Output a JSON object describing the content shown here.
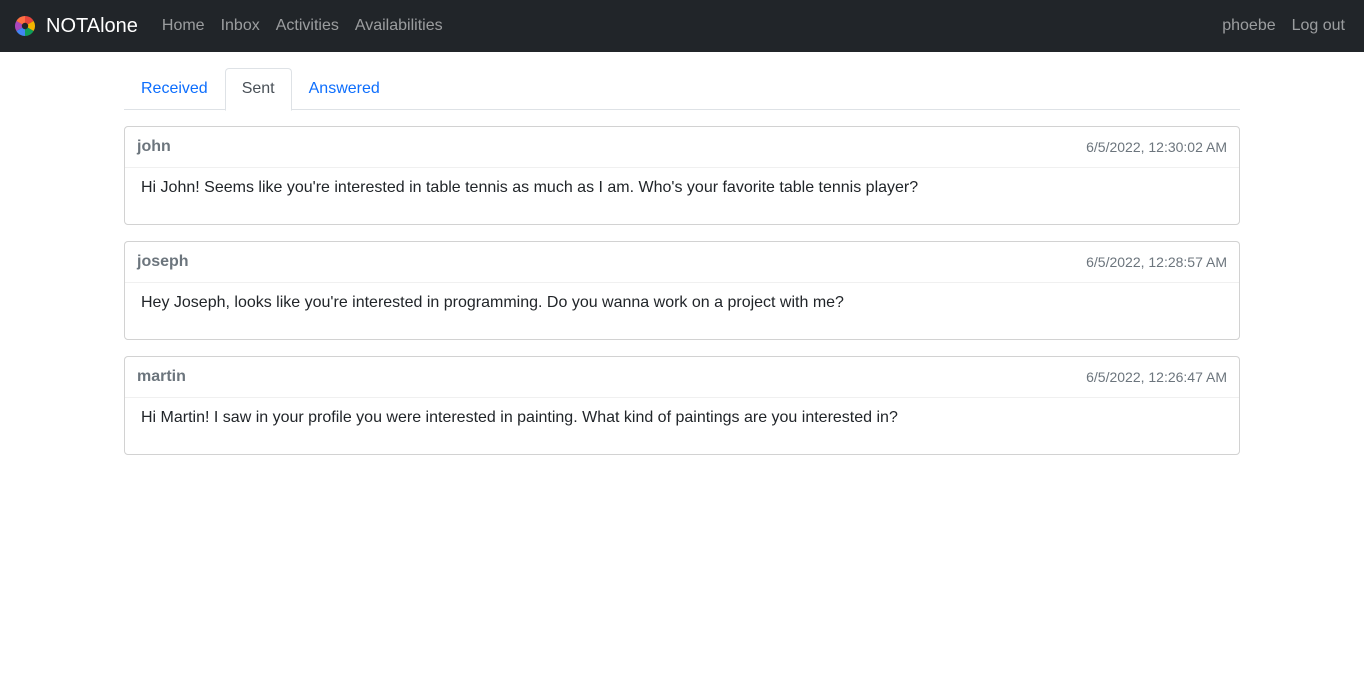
{
  "navbar": {
    "brand": "NOTAlone",
    "links": [
      "Home",
      "Inbox",
      "Activities",
      "Availabilities"
    ],
    "user": "phoebe",
    "logout": "Log out"
  },
  "tabs": [
    {
      "label": "Received",
      "active": false
    },
    {
      "label": "Sent",
      "active": true
    },
    {
      "label": "Answered",
      "active": false
    }
  ],
  "messages": [
    {
      "name": "john",
      "time": "6/5/2022, 12:30:02 AM",
      "text": "Hi John! Seems like you're interested in table tennis as much as I am. Who's your favorite table tennis player?"
    },
    {
      "name": "joseph",
      "time": "6/5/2022, 12:28:57 AM",
      "text": "Hey Joseph, looks like you're interested in programming. Do you wanna work on a project with me?"
    },
    {
      "name": "martin",
      "time": "6/5/2022, 12:26:47 AM",
      "text": "Hi Martin! I saw in your profile you were interested in painting. What kind of paintings are you interested in?"
    }
  ]
}
